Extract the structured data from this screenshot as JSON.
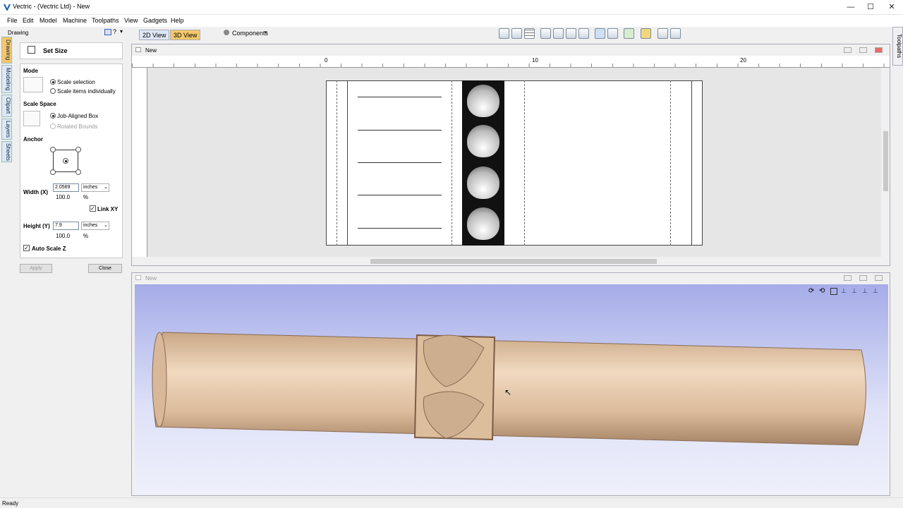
{
  "app": {
    "title": "Vectric - (Vectric Ltd) - New",
    "status": "Ready"
  },
  "menu": [
    "File",
    "Edit",
    "Model",
    "Machine",
    "Toolpaths",
    "View",
    "Gadgets",
    "Help"
  ],
  "tabs": {
    "view2d": "2D View",
    "view3d": "3D View",
    "components": "Components"
  },
  "side_tabs": [
    "Drawing",
    "Modeling",
    "Clipart",
    "Layers",
    "Sheets"
  ],
  "right_tab": "Toolpaths",
  "panel": {
    "header": "Drawing",
    "title": "Set Size",
    "mode": {
      "label": "Mode",
      "opt1": "Scale selection",
      "opt2": "Scale items individually"
    },
    "scale_space": {
      "label": "Scale Space",
      "opt1": "Job-Aligned Box",
      "opt2": "Rotated Bounds"
    },
    "anchor": {
      "label": "Anchor"
    },
    "width": {
      "label": "Width (X)",
      "value": "2.0569",
      "unit": "inches",
      "pct": "100.0",
      "pct_sym": "%"
    },
    "link": "Link XY",
    "height": {
      "label": "Height (Y)",
      "value": "7.9",
      "unit": "inches",
      "pct": "100.0",
      "pct_sym": "%"
    },
    "auto_z": "Auto Scale Z",
    "apply": "Apply",
    "close": "Close"
  },
  "win2d": {
    "title": "New",
    "ruler": [
      "0",
      "10",
      "20"
    ]
  },
  "win3d": {
    "title": "New"
  }
}
